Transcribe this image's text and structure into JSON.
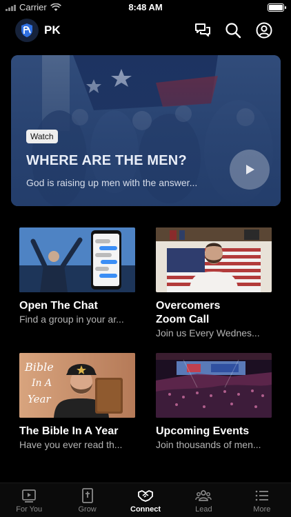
{
  "status_bar": {
    "carrier": "Carrier",
    "time": "8:48 AM"
  },
  "header": {
    "brand": "PK"
  },
  "hero": {
    "badge": "Watch",
    "title": "WHERE ARE THE MEN?",
    "subtitle": "God is raising up men with the answer..."
  },
  "cards": [
    {
      "title": "Open The Chat",
      "subtitle": "Find a group in your ar..."
    },
    {
      "title": "Overcomers Zoom Call",
      "subtitle": "Join us Every Wednes..."
    },
    {
      "title": "The Bible In A Year",
      "subtitle": "Have you ever read th..."
    },
    {
      "title": "Upcoming Events",
      "subtitle": "Join thousands of men..."
    }
  ],
  "tabbar": {
    "items": [
      {
        "label": "For You",
        "icon": "video-icon"
      },
      {
        "label": "Grow",
        "icon": "bible-icon"
      },
      {
        "label": "Connect",
        "icon": "handshake-icon",
        "active": true
      },
      {
        "label": "Lead",
        "icon": "group-icon"
      },
      {
        "label": "More",
        "icon": "menu-icon"
      }
    ]
  },
  "colors": {
    "background": "#000000",
    "hero_blue": "#3a5b8f",
    "inactive_tab": "#8a8a8a"
  }
}
